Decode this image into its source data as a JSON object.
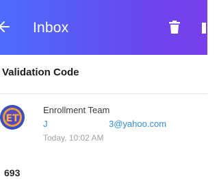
{
  "appbar": {
    "title": "Inbox",
    "back_icon": "back-arrow-icon",
    "delete_icon": "trash-icon",
    "overflow_icon": "overflow-menu-icon",
    "gradient_start": "#4d6cff",
    "gradient_end": "#7a3fea"
  },
  "message": {
    "subject": "Validation Code",
    "sender_name": "Enrollment Team",
    "sender_email_local": "J",
    "sender_email_domain": "3@yahoo.com",
    "timestamp": "Today, 10:02 AM",
    "body_preview": "693",
    "email_color": "#2f8fe6"
  },
  "avatar": {
    "initials": "ET",
    "colors": [
      "#3b4dbf",
      "#f0a030"
    ]
  }
}
